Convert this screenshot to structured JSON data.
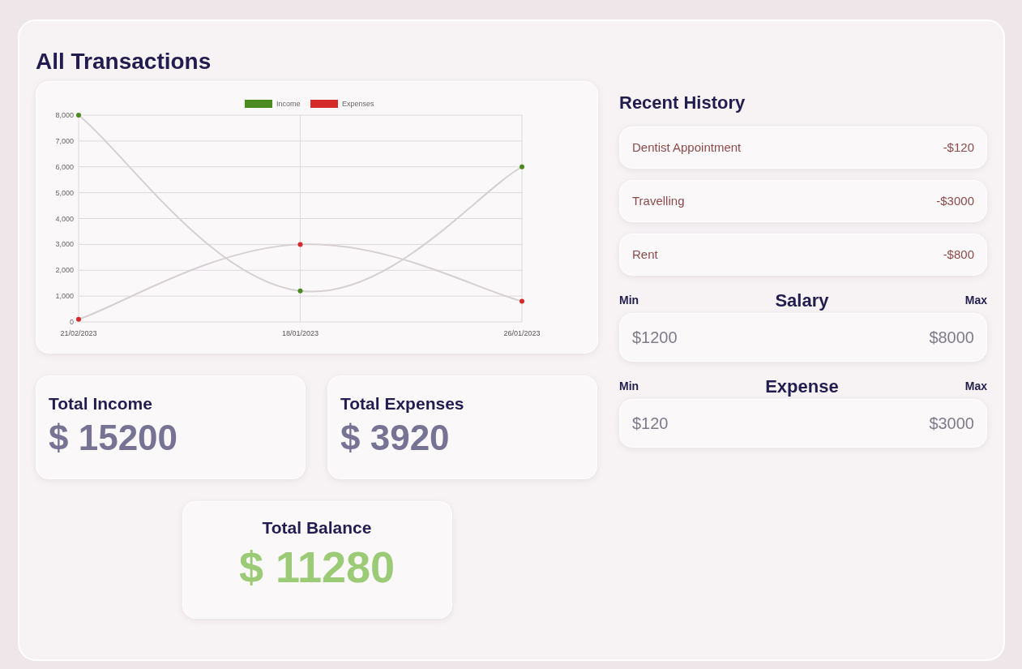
{
  "title": "All Transactions",
  "chart": {
    "chart_data": {
      "type": "line",
      "grid": true,
      "legend": true,
      "categories": [
        "21/02/2023",
        "18/01/2023",
        "26/01/2023"
      ],
      "ylim": [
        0,
        8000
      ],
      "yticks": [
        0,
        {
          "value": 1000,
          "label": "1,000"
        },
        {
          "value": 2000,
          "label": "2,000"
        },
        {
          "value": 3000,
          "label": "3,000"
        },
        {
          "value": 4000,
          "label": "4,000"
        },
        {
          "value": 5000,
          "label": "5,000"
        },
        {
          "value": 6000,
          "label": "6,000"
        },
        {
          "value": 7000,
          "label": "7,000"
        },
        {
          "value": 8000,
          "label": "8,000"
        }
      ],
      "series": [
        {
          "name": "Income",
          "color": "#4a8a1e",
          "marker": "circle",
          "values": [
            8000,
            1200,
            6000
          ]
        },
        {
          "name": "Expenses",
          "color": "#d42a2a",
          "marker": "circle",
          "values": [
            100,
            3000,
            800
          ]
        }
      ]
    }
  },
  "totals": [
    {
      "label": "Total Income",
      "value": "$ 15200"
    },
    {
      "label": "Total Expenses",
      "value": "$ 3920"
    }
  ],
  "balance": {
    "label": "Total Balance",
    "value": "$ 11280"
  },
  "history": {
    "title": "Recent History",
    "items": [
      {
        "name": "Dentist Appointment",
        "amount": "-$120"
      },
      {
        "name": "Travelling",
        "amount": "-$3000"
      },
      {
        "name": "Rent",
        "amount": "-$800"
      }
    ]
  },
  "ranges": [
    {
      "min_label": "Min",
      "title": "Salary",
      "max_label": "Max",
      "min": "$1200",
      "max": "$8000"
    },
    {
      "min_label": "Min",
      "title": "Expense",
      "max_label": "Max",
      "min": "$120",
      "max": "$3000"
    }
  ]
}
